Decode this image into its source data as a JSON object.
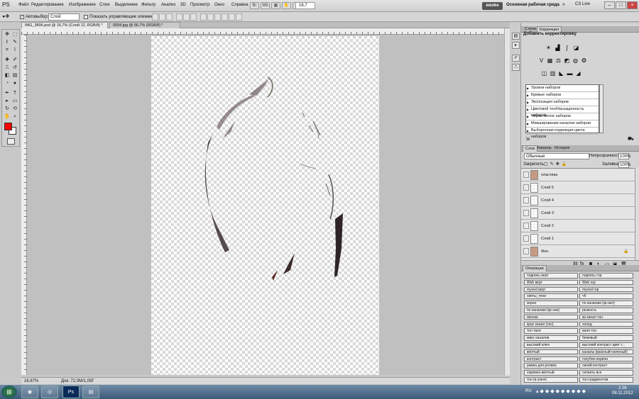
{
  "app": {
    "logo": "PS"
  },
  "menu": [
    "Файл",
    "Редактирование",
    "Изображение",
    "Слои",
    "Выделение",
    "Фильтр",
    "Анализ",
    "3D",
    "Просмотр",
    "Окно",
    "Справка"
  ],
  "title_bar": {
    "zoom": "16,7",
    "workspace_button": "ewoke",
    "workspace_name": "Основная рабочая среда",
    "cs_live": "CS Live"
  },
  "options_bar": {
    "auto_select_label": "Автовыбор:",
    "auto_select_value": "Слой",
    "show_controls_label": "Показать управляющие элементы"
  },
  "documents": [
    {
      "label": "IMG_3896.psd @ 16,7% (Слой 12, RGB/8) *"
    },
    {
      "label": "0004.jpg @ 66,7% (RGB/8) *"
    }
  ],
  "status": {
    "zoom": "16,67%",
    "doc": "Док: 72,0M/1,09Г"
  },
  "colors": {
    "foreground": "#ff0000",
    "background": "#ffffff"
  },
  "adjustments_panel": {
    "tabs": [
      "Стили",
      "Коррекция"
    ],
    "title": "Добавить корректировку",
    "presets": [
      "Уровни наборов",
      "Кривые наборов",
      "Экспозиция наборов",
      "Цветовой тон/Насыщенность наборов",
      "Черно-белое наборов",
      "Микширование каналов наборов",
      "Выборочная коррекция цвета наборов"
    ]
  },
  "layers_panel": {
    "tabs": [
      "Слои",
      "Каналы",
      "История"
    ],
    "blend_mode": "Обычные",
    "opacity_label": "Непрозрачность:",
    "opacity": "100%",
    "lock_label": "Закрепить:",
    "fill_label": "Заливка:",
    "fill": "100%",
    "layers": [
      {
        "name": "пластика",
        "thumb": "photo"
      },
      {
        "name": "Слой 5",
        "thumb": "checker"
      },
      {
        "name": "Слой 4",
        "thumb": "checker"
      },
      {
        "name": "Слой 3",
        "thumb": "checker"
      },
      {
        "name": "Слой 2",
        "thumb": "checker"
      },
      {
        "name": "Слой 1",
        "thumb": "checker"
      },
      {
        "name": "Фон",
        "thumb": "photo"
      }
    ]
  },
  "actions_panel": {
    "tab": "Операции",
    "actions": [
      [
        "подпись верт",
        "подпись гор"
      ],
      [
        "Web верт",
        "Web гор"
      ],
      [
        "myved верт",
        "myved гор"
      ],
      [
        "светы_тени",
        "чб"
      ],
      [
        "зерно",
        "по каналам (кр-зел)"
      ],
      [
        "по каналам (кр-син)",
        "резкость"
      ],
      [
        "иконка",
        "кр канал тон"
      ],
      [
        "крас канал (тон)",
        "холод"
      ],
      [
        "тон таня",
        "валя тон"
      ],
      [
        "микс каналов",
        "бежевый"
      ],
      [
        "высокий ключ",
        "высокий контраст цвет т..."
      ],
      [
        "жёлтый",
        "каналы (красный+зеленый)"
      ],
      [
        "контраст",
        "голубое-корича"
      ],
      [
        "рамка для ролика",
        "синий контраст"
      ],
      [
        "скремно-жёлтый",
        "склеить все"
      ],
      [
        "тон (в ключ)",
        "тон градиентом"
      ]
    ]
  },
  "taskbar": {
    "lang": "RU",
    "time": "2:26",
    "date": "08.11.2012"
  }
}
